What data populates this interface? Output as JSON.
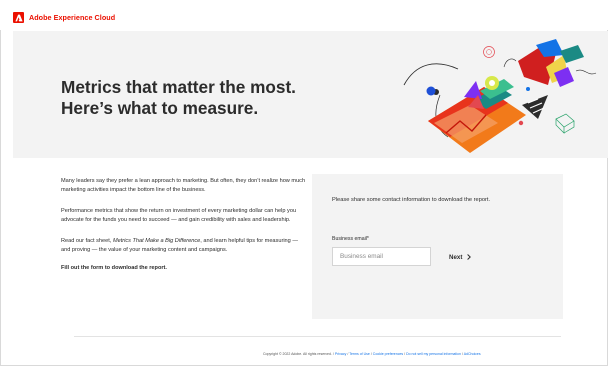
{
  "brand": {
    "name": "Adobe Experience Cloud",
    "logo": "adobe-logo",
    "color": "#eb1000"
  },
  "hero": {
    "title": "Metrics that matter the most. Here’s what to measure."
  },
  "content": {
    "p1": "Many leaders say they prefer a lean approach to marketing. But often, they don’t realize how much marketing activities impact the bottom line of the business.",
    "p2": "Performance metrics that show the return on investment of every marketing dollar can help you advocate for the funds you need to succeed — and gain credibility with sales and leadership.",
    "p3_before": "Read our fact sheet, ",
    "p3_title": "Metrics That Make a Big Difference",
    "p3_after": ", and learn helpful tips for measuring — and proving — the value of your marketing content and campaigns.",
    "cta": "Fill out the form to download the report."
  },
  "form": {
    "intro": "Please share some contact information to download the report.",
    "email_label": "Business email*",
    "email_placeholder": "Business email",
    "email_value": "",
    "next_label": "Next",
    "next_icon": "chevron-right-icon"
  },
  "footer": {
    "copyright": "Copyright © 2022 Adobe. All rights reserved.",
    "links": [
      "Privacy",
      "Terms of Use",
      "Cookie preferences",
      "Do not sell my personal information",
      "AdChoices"
    ],
    "link_color": "#1473e6"
  }
}
